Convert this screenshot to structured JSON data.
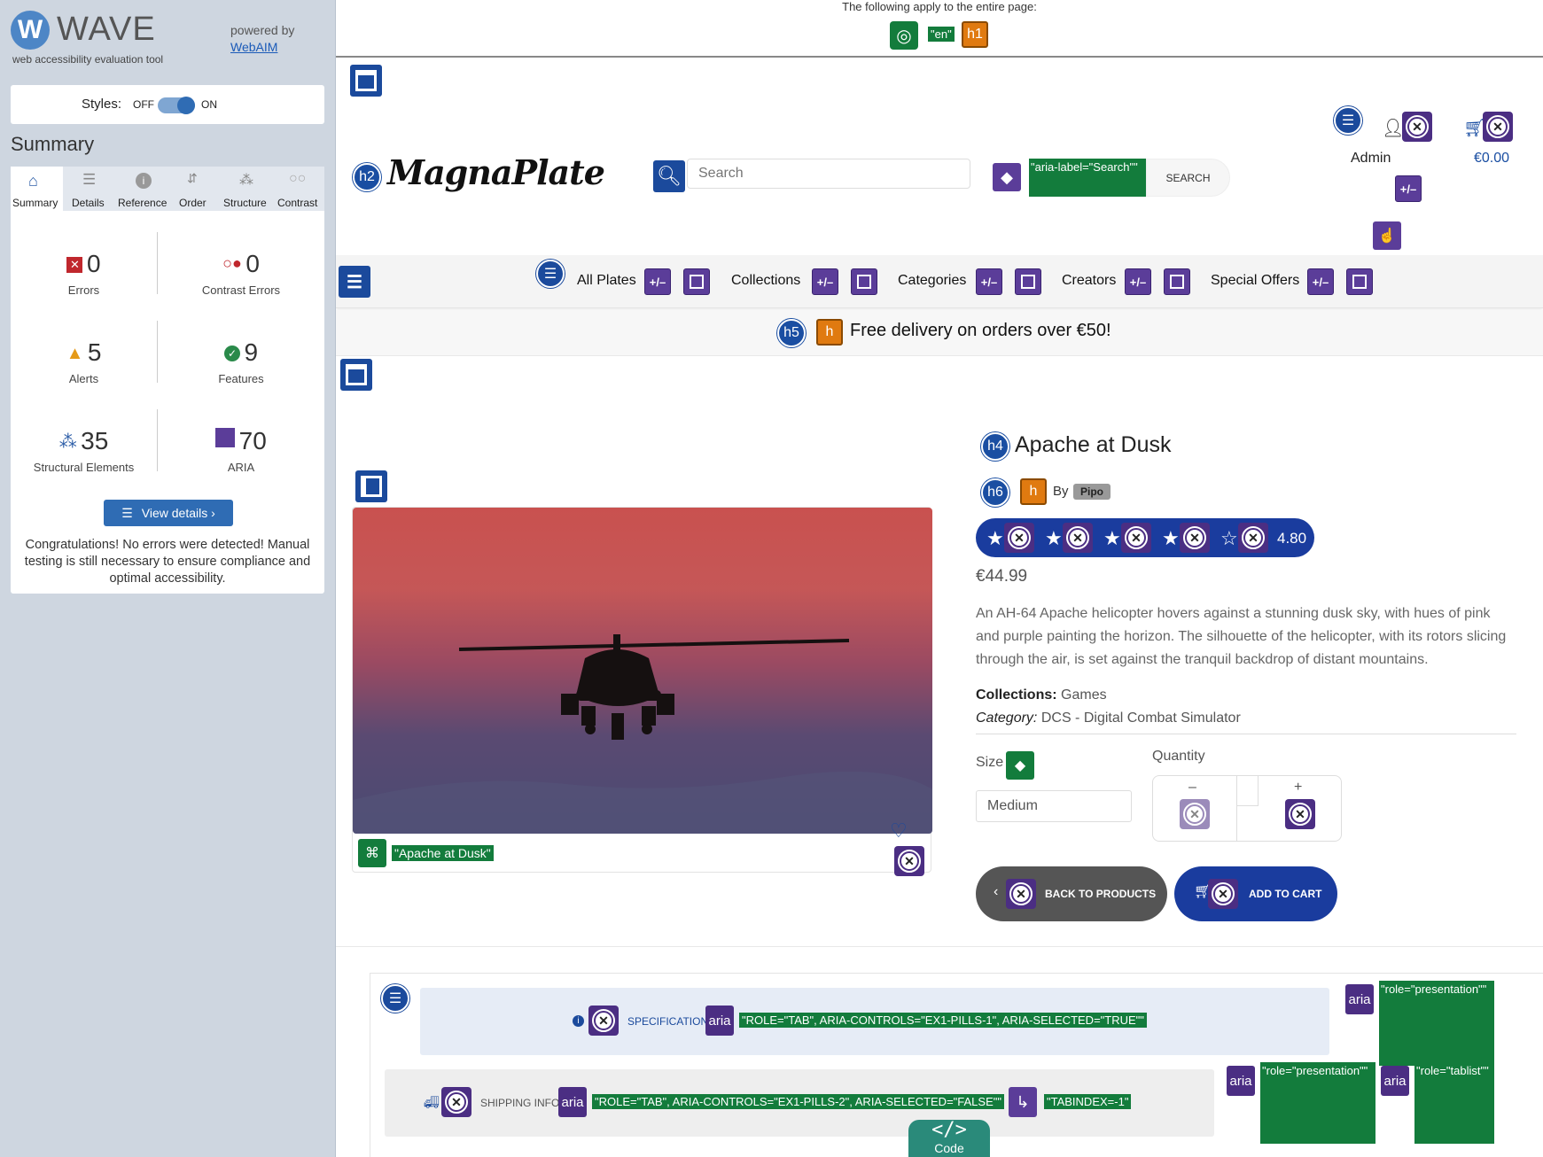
{
  "wave": {
    "logo_text": "WAVE",
    "tagline": "web accessibility evaluation tool",
    "powered_by": "powered by",
    "webaim_link": "WebAIM",
    "styles_label": "Styles:",
    "styles_off": "OFF",
    "styles_on": "ON",
    "summary_heading": "Summary",
    "tabs": [
      {
        "label": "Summary",
        "icon": "home-icon"
      },
      {
        "label": "Details",
        "icon": "list-icon"
      },
      {
        "label": "Reference",
        "icon": "info-icon"
      },
      {
        "label": "Order",
        "icon": "order-icon"
      },
      {
        "label": "Structure",
        "icon": "structure-icon"
      },
      {
        "label": "Contrast",
        "icon": "contrast-icon"
      }
    ],
    "stats": {
      "errors": {
        "count": "0",
        "label": "Errors"
      },
      "contrast": {
        "count": "0",
        "label": "Contrast Errors"
      },
      "alerts": {
        "count": "5",
        "label": "Alerts"
      },
      "features": {
        "count": "9",
        "label": "Features"
      },
      "structural": {
        "count": "35",
        "label": "Structural Elements"
      },
      "aria": {
        "count": "70",
        "label": "ARIA"
      }
    },
    "view_details": "View details ›",
    "congrats": "Congratulations! No errors were detected! Manual testing is still necessary to ensure compliance and optimal accessibility."
  },
  "page_top": {
    "apply_text": "The following apply to the entire page:",
    "lang_label": "\"en\"",
    "h1_label": "h1"
  },
  "header": {
    "h2_badge": "h2",
    "brand": "MagnaPlate",
    "search_placeholder": "Search",
    "aria_label_tag": "\"aria-label=\"Search\"\"",
    "search_button": "SEARCH",
    "admin_label": "Admin",
    "cart_total": "€0.00",
    "pm": "+/–"
  },
  "nav": {
    "items": [
      "All Plates",
      "Collections",
      "Categories",
      "Creators",
      "Special Offers"
    ]
  },
  "banner": {
    "h5_badge": "h5",
    "h_label": "h",
    "text": "Free delivery on orders over €50!"
  },
  "product": {
    "h4_badge": "h4",
    "title": "Apache at Dusk",
    "h6_badge": "h6",
    "by_label": "By",
    "creator": "Pipo",
    "rating": "4.80",
    "price": "€44.99",
    "description": "An AH-64 Apache helicopter hovers against a stunning dusk sky, with hues of pink and purple painting the horizon. The silhouette of the helicopter, with its rotors slicing through the air, is set against the tranquil backdrop of distant mountains.",
    "collections_label": "Collections:",
    "collections_value": "Games",
    "category_label": "Category:",
    "category_value": "DCS - Digital Combat Simulator",
    "size_label": "Size",
    "size_value": "Medium",
    "quantity_label": "Quantity",
    "qty_minus": "–",
    "qty_plus": "+",
    "back_button": "BACK TO PRODUCTS",
    "add_button": "ADD TO CART",
    "image_alt_label": "\"Apache at Dusk\""
  },
  "tabs_section": {
    "spec_label": "SPECIFICATION",
    "spec_aria": "\"ROLE=\"TAB\", ARIA-CONTROLS=\"EX1-PILLS-1\", ARIA-SELECTED=\"TRUE\"\"",
    "ship_label": "SHIPPING INFO",
    "ship_aria": "\"ROLE=\"TAB\", ARIA-CONTROLS=\"EX1-PILLS-2\", ARIA-SELECTED=\"FALSE\"\"",
    "tabindex": "\"TABINDEX=-1\"",
    "role_presentation": "\"role=\"presentation\"\"",
    "role_tablist": "\"role=\"tablist\"\"",
    "aria_word": "aria",
    "code_label": "Code"
  }
}
